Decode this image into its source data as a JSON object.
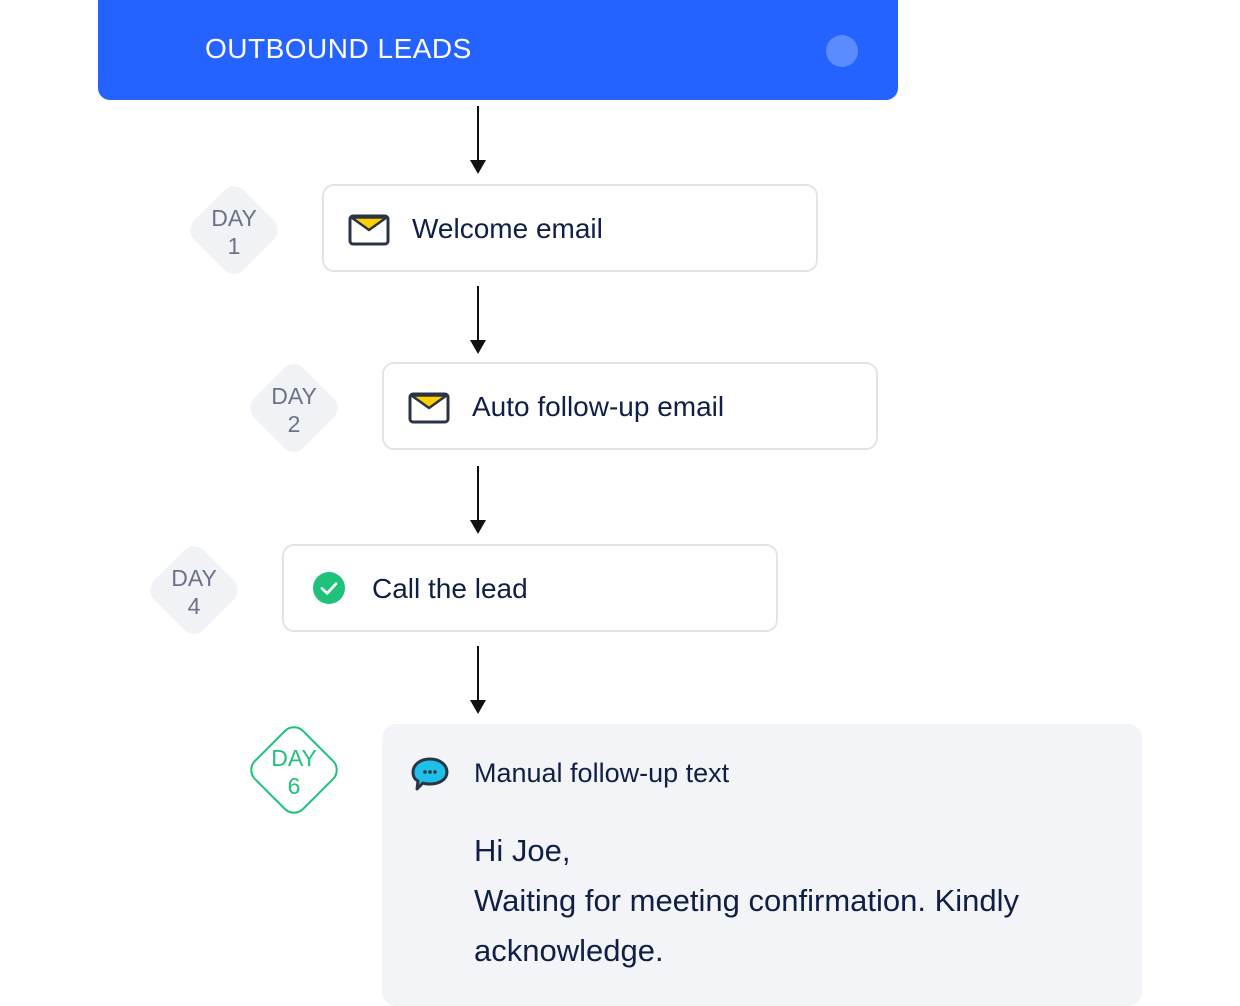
{
  "header": {
    "title": "OUTBOUND LEADS"
  },
  "steps": [
    {
      "day_word": "DAY",
      "day_num": "1",
      "icon": "envelope-icon",
      "label": "Welcome email"
    },
    {
      "day_word": "DAY",
      "day_num": "2",
      "icon": "envelope-icon",
      "label": "Auto follow-up email"
    },
    {
      "day_word": "DAY",
      "day_num": "4",
      "icon": "check-circle-icon",
      "label": "Call the lead"
    }
  ],
  "sms_step": {
    "day_word": "DAY",
    "day_num": "6",
    "icon": "chat-bubble-icon",
    "title": "Manual follow-up text",
    "greeting": "Hi Joe,",
    "message": "Waiting for meeting confirmation. Kindly acknowledge."
  },
  "colors": {
    "header_bg": "#2463ff",
    "active_day": "#1ec27a",
    "text": "#0f1f45",
    "envelope_flap": "#ffd000",
    "chat_bubble": "#1ec0e6"
  }
}
